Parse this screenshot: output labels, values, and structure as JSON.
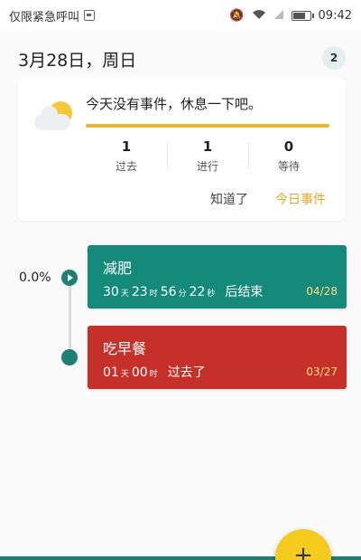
{
  "status_bar": {
    "carrier": "仅限紧急呼叫",
    "time": "09:42",
    "icons": [
      "sim-icon",
      "mute-icon",
      "wifi-icon",
      "signal-icon",
      "battery-icon"
    ],
    "battery_level": 0.8
  },
  "header": {
    "date": "3月28日，周日",
    "event_count": "2"
  },
  "summary": {
    "message": "今天没有事件，休息一下吧。",
    "progress": 1.0,
    "stats": [
      {
        "value": "1",
        "label": "过去"
      },
      {
        "value": "1",
        "label": "进行"
      },
      {
        "value": "0",
        "label": "等待"
      }
    ],
    "ack_label": "知道了",
    "today_label": "今日事件",
    "accent_color": "#f0b42a"
  },
  "timeline": {
    "percent": "0.0%"
  },
  "events": [
    {
      "title": "减肥",
      "days": "30",
      "days_unit": "天",
      "hours": "23",
      "hours_unit": "时",
      "minutes": "56",
      "minutes_unit": "分",
      "seconds": "22",
      "seconds_unit": "秒",
      "suffix": "后结束",
      "date": "04/28",
      "color": "#15897a"
    },
    {
      "title": "吃早餐",
      "days": "01",
      "days_unit": "天",
      "hours": "00",
      "hours_unit": "时",
      "suffix": "过去了",
      "date": "03/27",
      "color": "#c6302b"
    }
  ],
  "fab": {
    "label": "+"
  }
}
